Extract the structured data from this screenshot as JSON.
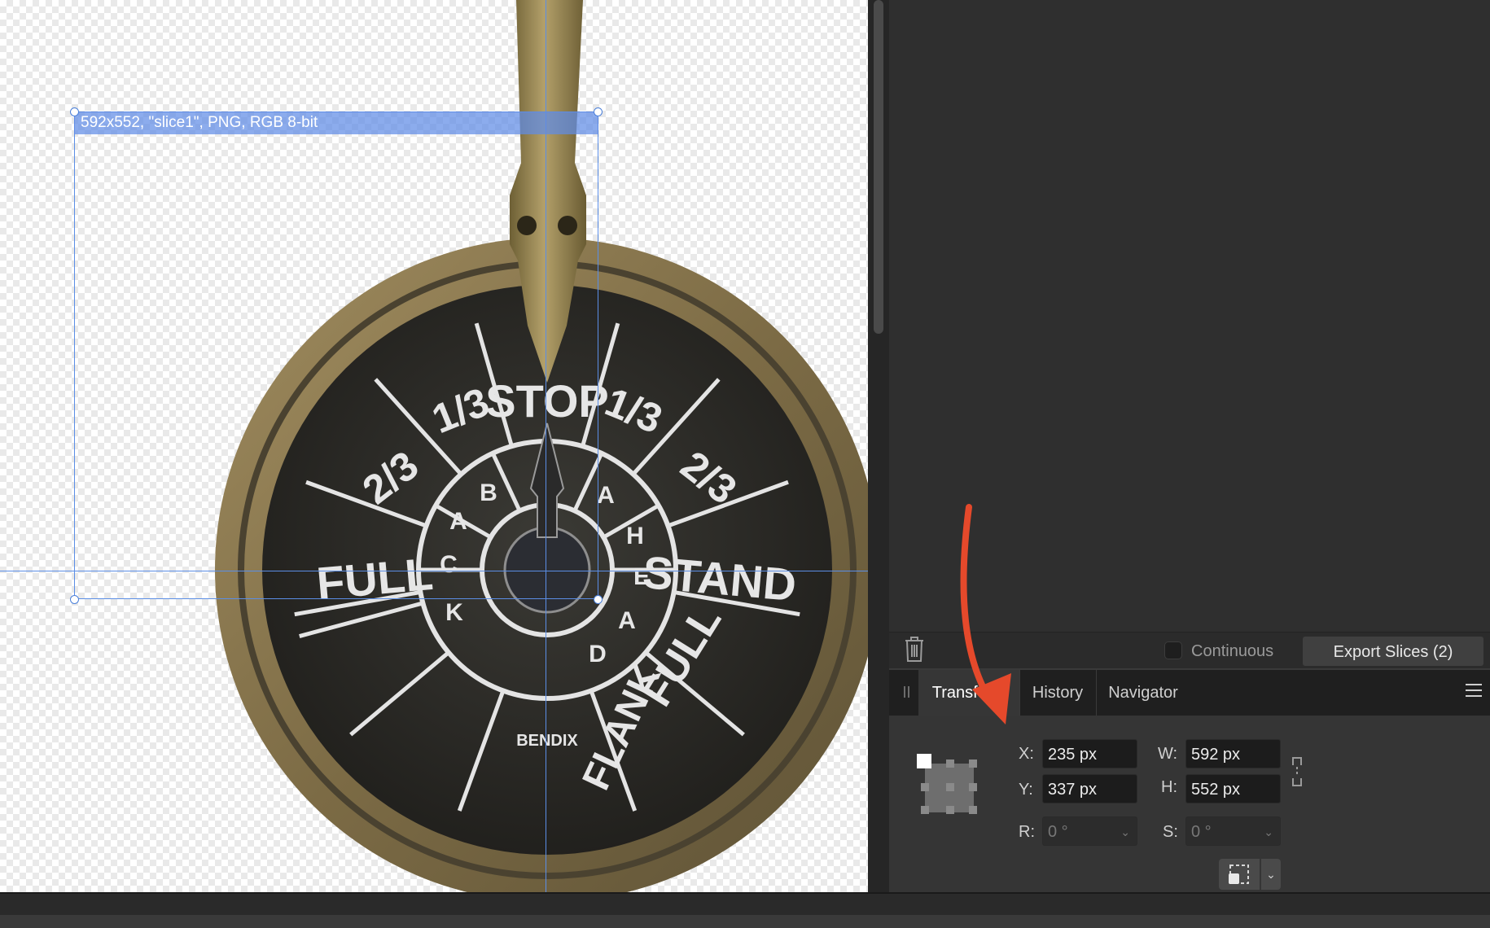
{
  "canvas": {
    "slice_label": "592x552, \"slice1\", PNG, RGB 8-bit",
    "dial": {
      "top": [
        "1/3",
        "STOP",
        "1/3"
      ],
      "ahead": [
        "A",
        "H",
        "E",
        "A",
        "D"
      ],
      "back": [
        "B",
        "A",
        "C",
        "K"
      ],
      "left_speeds": [
        "2/3",
        "FULL"
      ],
      "right_speeds": [
        "2/3",
        "STAND",
        "FULL",
        "FLANK"
      ],
      "brand": "BENDIX"
    }
  },
  "slices_footer": {
    "continuous_label": "Continuous",
    "export_label": "Export Slices (2)"
  },
  "tabs": [
    {
      "label": "Transform",
      "active": true
    },
    {
      "label": "History",
      "active": false
    },
    {
      "label": "Navigator",
      "active": false
    }
  ],
  "transform": {
    "x_label": "X:",
    "x_value": "235 px",
    "y_label": "Y:",
    "y_value": "337 px",
    "w_label": "W:",
    "w_value": "592 px",
    "h_label": "H:",
    "h_value": "552 px",
    "r_label": "R:",
    "r_value": "0 °",
    "s_label": "S:",
    "s_value": "0 °"
  },
  "icons": {
    "trash": "trash-icon",
    "link": "link-icon",
    "menu": "hamburger-menu-icon",
    "transform_origin": "transform-origin-icon",
    "annotation_arrow": "red-arrow-icon"
  },
  "colors": {
    "accent_blue": "#5b8ee6",
    "arrow_red": "#e5492b",
    "brass": "#8a7a55",
    "dial_face": "#2a2925"
  }
}
